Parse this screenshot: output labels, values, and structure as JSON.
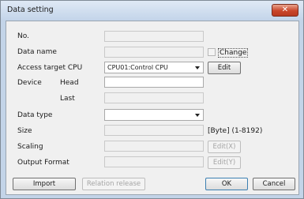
{
  "window": {
    "title": "Data setting",
    "close_glyph": "✕"
  },
  "labels": {
    "no": "No.",
    "data_name": "Data name",
    "access_target_cpu": "Access target CPU",
    "device": "Device",
    "head": "Head",
    "last": "Last",
    "data_type": "Data type",
    "size": "Size",
    "scaling": "Scaling",
    "output_format": "Output Format"
  },
  "fields": {
    "access_target_cpu_value": "CPU01:Control CPU",
    "data_type_value": ""
  },
  "size_hint": "[Byte] (1-8192)",
  "checkbox": {
    "change_label": "Change",
    "checked": false
  },
  "buttons": {
    "edit_cpu": "Edit",
    "edit_scaling": "Edit(X)",
    "edit_output": "Edit(Y)",
    "import": "Import",
    "relation_release": "Relation release",
    "ok": "OK",
    "cancel": "Cancel"
  },
  "icons": {
    "close": "close-icon",
    "dropdown": "chevron-down-icon"
  }
}
